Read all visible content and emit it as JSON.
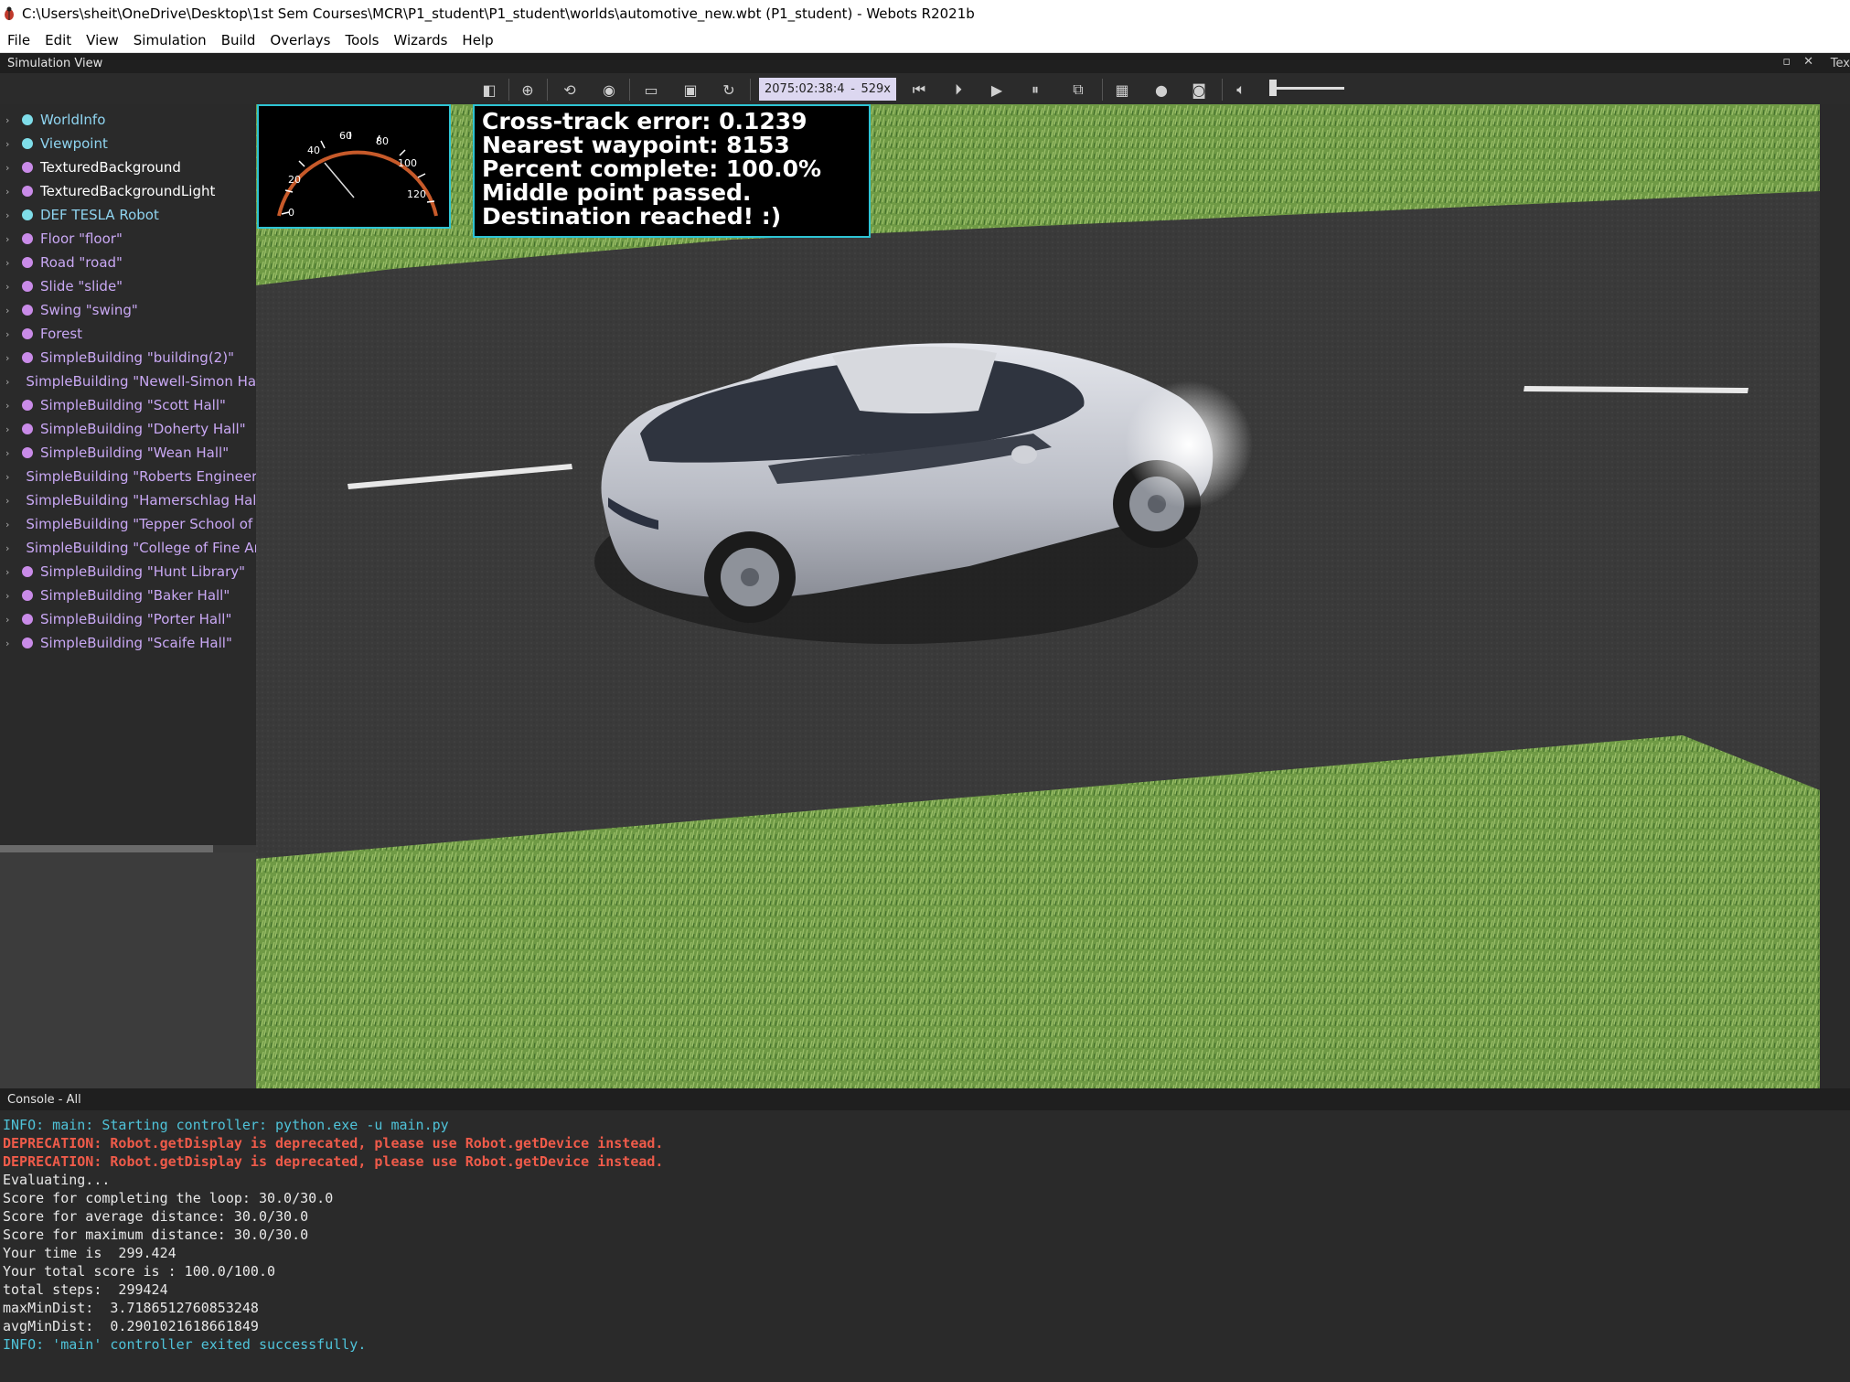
{
  "window": {
    "title": "C:\\Users\\sheit\\OneDrive\\Desktop\\1st Sem Courses\\MCR\\P1_student\\P1_student\\worlds\\automotive_new.wbt (P1_student) - Webots R2021b"
  },
  "menu": [
    "File",
    "Edit",
    "View",
    "Simulation",
    "Build",
    "Overlays",
    "Tools",
    "Wizards",
    "Help"
  ],
  "simulation_view": {
    "label": "Simulation View",
    "right_label": "Tex"
  },
  "toolbar": {
    "time": "2075:02:38:4",
    "separator": "-",
    "speed": "529x"
  },
  "scene_tree": {
    "items": [
      {
        "label": "WorldInfo",
        "color": "#7fdde9"
      },
      {
        "label": "Viewpoint",
        "color": "#7fdde9"
      },
      {
        "label": "TexturedBackground",
        "color": "#c98be8"
      },
      {
        "label": "TexturedBackgroundLight",
        "color": "#c98be8"
      },
      {
        "label": "DEF TESLA Robot",
        "color": "#7fdde9"
      },
      {
        "label": "Floor \"floor\"",
        "color": "#c98be8"
      },
      {
        "label": "Road \"road\"",
        "color": "#c98be8"
      },
      {
        "label": "Slide \"slide\"",
        "color": "#c98be8"
      },
      {
        "label": "Swing \"swing\"",
        "color": "#c98be8"
      },
      {
        "label": "Forest",
        "color": "#c98be8"
      },
      {
        "label": "SimpleBuilding \"building(2)\"",
        "color": "#c98be8"
      },
      {
        "label": "SimpleBuilding \"Newell-Simon Hall\"",
        "color": "#c98be8"
      },
      {
        "label": "SimpleBuilding \"Scott Hall\"",
        "color": "#c98be8"
      },
      {
        "label": "SimpleBuilding \"Doherty Hall\"",
        "color": "#c98be8"
      },
      {
        "label": "SimpleBuilding \"Wean Hall\"",
        "color": "#c98be8"
      },
      {
        "label": "SimpleBuilding \"Roberts Engineering",
        "color": "#c98be8"
      },
      {
        "label": "SimpleBuilding \"Hamerschlag Hall\"",
        "color": "#c98be8"
      },
      {
        "label": "SimpleBuilding \"Tepper School of Bu",
        "color": "#c98be8"
      },
      {
        "label": "SimpleBuilding \"College of Fine Arts",
        "color": "#c98be8"
      },
      {
        "label": "SimpleBuilding \"Hunt Library\"",
        "color": "#c98be8"
      },
      {
        "label": "SimpleBuilding \"Baker Hall\"",
        "color": "#c98be8"
      },
      {
        "label": "SimpleBuilding \"Porter Hall\"",
        "color": "#c98be8"
      },
      {
        "label": "SimpleBuilding \"Scaife Hall\"",
        "color": "#c98be8"
      }
    ]
  },
  "hud": {
    "lines": [
      "Cross-track error: 0.1239",
      "Nearest waypoint: 8153",
      "Percent complete: 100.0%",
      "Middle point passed.",
      "Destination reached! :)"
    ]
  },
  "speedometer": {
    "ticks": [
      "0",
      "20",
      "40",
      "60",
      "80",
      "100",
      "120"
    ]
  },
  "console": {
    "label": "Console - All",
    "lines": [
      {
        "text": "INFO: main: Starting controller: python.exe -u main.py",
        "color": "#4fc3d9",
        "bold": false
      },
      {
        "text": "DEPRECATION: Robot.getDisplay is deprecated, please use Robot.getDevice instead.",
        "color": "#ef5b4a",
        "bold": true
      },
      {
        "text": "DEPRECATION: Robot.getDisplay is deprecated, please use Robot.getDevice instead.",
        "color": "#ef5b4a",
        "bold": true
      },
      {
        "text": "Evaluating...",
        "color": "#e8e8e8",
        "bold": false
      },
      {
        "text": "Score for completing the loop: 30.0/30.0",
        "color": "#e8e8e8",
        "bold": false
      },
      {
        "text": "Score for average distance: 30.0/30.0",
        "color": "#e8e8e8",
        "bold": false
      },
      {
        "text": "Score for maximum distance: 30.0/30.0",
        "color": "#e8e8e8",
        "bold": false
      },
      {
        "text": "Your time is  299.424",
        "color": "#e8e8e8",
        "bold": false
      },
      {
        "text": "Your total score is : 100.0/100.0",
        "color": "#e8e8e8",
        "bold": false
      },
      {
        "text": "total steps:  299424",
        "color": "#e8e8e8",
        "bold": false
      },
      {
        "text": "maxMinDist:  3.7186512760853248",
        "color": "#e8e8e8",
        "bold": false
      },
      {
        "text": "avgMinDist:  0.2901021618661849",
        "color": "#e8e8e8",
        "bold": false
      },
      {
        "text": "INFO: 'main' controller exited successfully.",
        "color": "#4fc3d9",
        "bold": false
      }
    ]
  }
}
